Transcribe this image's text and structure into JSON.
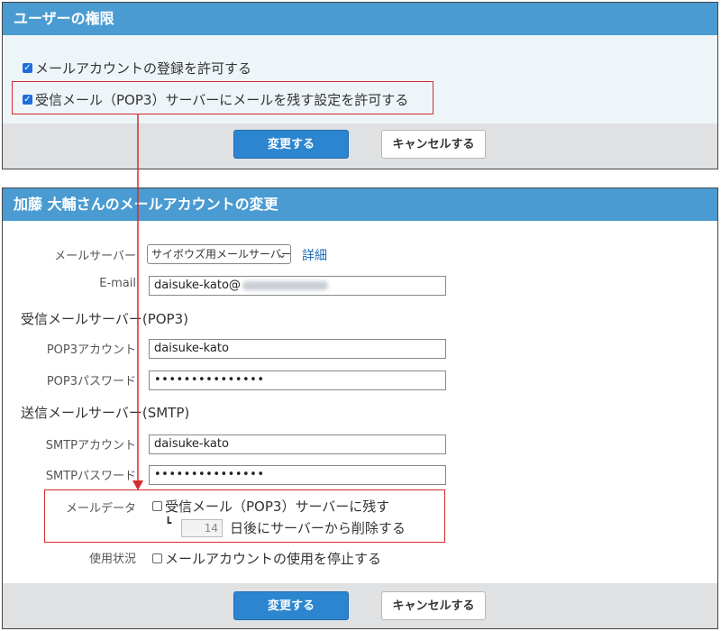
{
  "perm_panel": {
    "title": "ユーザーの権限",
    "allow_register_label": "メールアカウントの登録を許可する",
    "allow_leave_label": "受信メール（POP3）サーバーにメールを残す設定を許可する",
    "change_button": "変更する",
    "cancel_button": "キャンセルする"
  },
  "account_panel": {
    "title": "加藤 大輔さんのメールアカウントの変更",
    "mail_server_label": "メールサーバー",
    "mail_server_value": "サイボウズ用メールサーバー",
    "detail_link": "詳細",
    "email_label": "E-mail",
    "email_value": "daisuke-kato@",
    "pop3_section": "受信メールサーバー(POP3)",
    "pop3_account_label": "POP3アカウント",
    "pop3_account_value": "daisuke-kato",
    "pop3_password_label": "POP3パスワード",
    "pop3_password_value": "•••••••••••••••",
    "smtp_section": "送信メールサーバー(SMTP)",
    "smtp_account_label": "SMTPアカウント",
    "smtp_account_value": "daisuke-kato",
    "smtp_password_label": "SMTPパスワード",
    "smtp_password_value": "•••••••••••••••",
    "mail_data_label": "メールデータ",
    "leave_on_server_label": "受信メール（POP3）サーバーに残す",
    "days_value": "14",
    "days_suffix": "日後にサーバーから削除する",
    "usage_label": "使用状況",
    "stop_usage_label": "メールアカウントの使用を停止する",
    "change_button": "変更する",
    "cancel_button": "キャンセルする"
  },
  "colors": {
    "header": "#4a9bd1",
    "primary_button": "#2c86cf",
    "highlight": "#d62b2b"
  }
}
